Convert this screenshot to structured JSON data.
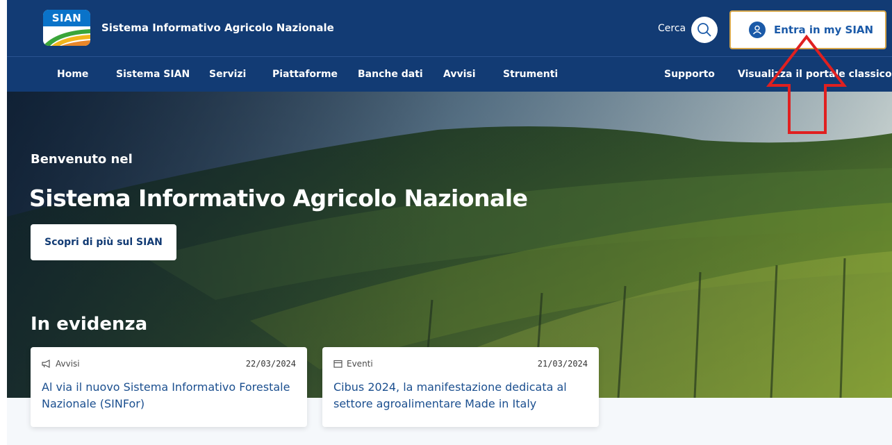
{
  "header": {
    "logo_text": "SIAN",
    "site_title": "Sistema Informativo Agricolo Nazionale",
    "search_label": "Cerca",
    "login_label": "Entra in my SIAN"
  },
  "nav": {
    "items": [
      {
        "label": "Home"
      },
      {
        "label": "Sistema SIAN"
      },
      {
        "label": "Servizi"
      },
      {
        "label": "Piattaforme"
      },
      {
        "label": "Banche dati"
      },
      {
        "label": "Avvisi"
      },
      {
        "label": "Strumenti"
      },
      {
        "label": "Supporto"
      },
      {
        "label": "Visualizza il portale classico"
      }
    ]
  },
  "hero": {
    "welcome": "Benvenuto nel",
    "title": "Sistema Informativo Agricolo Nazionale",
    "cta_label": "Scopri di più sul SIAN"
  },
  "highlights": {
    "title": "In evidenza",
    "cards": [
      {
        "category": "Avvisi",
        "date": "22/03/2024",
        "title": "Al via il nuovo Sistema Informativo Forestale Nazionale (SINFor)"
      },
      {
        "category": "Eventi",
        "date": "21/03/2024",
        "title": "Cibus 2024, la manifestazione dedicata al settore agroalimentare Made in Italy"
      }
    ]
  },
  "colors": {
    "header_bg": "#123b74",
    "accent": "#1b5aa8",
    "login_border": "#d6a64a",
    "annotation_arrow": "#e02020"
  },
  "icons": {
    "search": "search-icon",
    "user": "user-icon",
    "avvisi": "megaphone-icon",
    "eventi": "calendar-icon"
  }
}
